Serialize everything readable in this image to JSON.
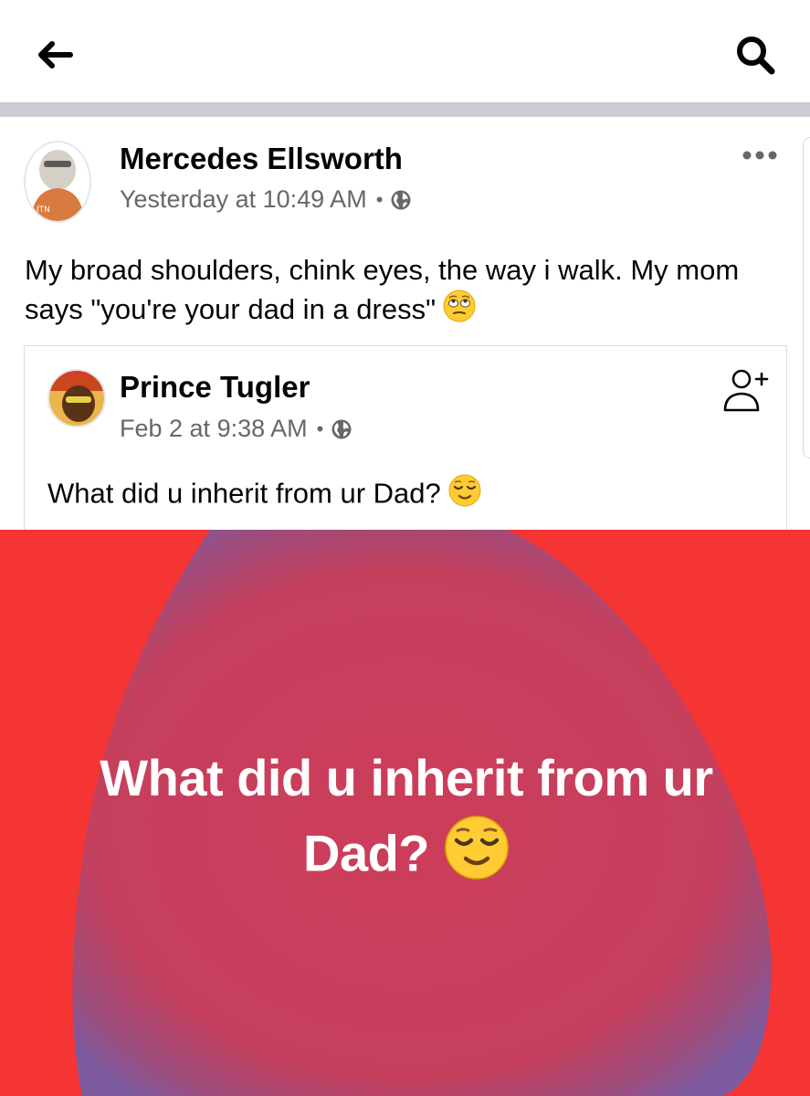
{
  "nav": {
    "back_icon": "arrow-left-icon",
    "search_icon": "search-icon"
  },
  "post": {
    "author": "Mercedes Ellsworth",
    "timestamp": "Yesterday at 10:49 AM",
    "audience_icon": "globe-icon",
    "more_icon": "more-dots-icon",
    "text": "My broad shoulders, chink eyes, the way i walk. My mom says \"you're your dad in a dress\"",
    "text_emoji": "eye-roll-emoji"
  },
  "shared_post": {
    "author": "Prince Tugler",
    "timestamp": "Feb 2 at 9:38 AM",
    "audience_icon": "globe-icon",
    "add_friend_icon": "add-friend-icon",
    "text": "What did u inherit from ur Dad?",
    "text_emoji": "relieved-emoji",
    "background_text_line1": "What did u inherit from ur",
    "background_text_line2": "Dad?",
    "background_colors": {
      "base": "#f53434",
      "blob": "#cc3d5a",
      "blob_edge": "#7d5a9e"
    }
  },
  "colors": {
    "divider": "#c9ccd1",
    "secondary_text": "#65676b",
    "primary_text": "#050505"
  }
}
